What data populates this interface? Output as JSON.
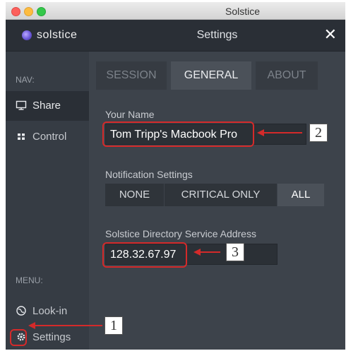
{
  "window": {
    "title": "Solstice"
  },
  "logo": {
    "text": "solstice"
  },
  "sidebar": {
    "nav_label": "NAV:",
    "nav_items": [
      {
        "label": "Share",
        "icon": "monitor-icon"
      },
      {
        "label": "Control",
        "icon": "grid-icon"
      }
    ],
    "menu_label": "MENU:",
    "menu_items": [
      {
        "label": "Look-in",
        "icon": "globe-icon"
      },
      {
        "label": "Settings",
        "icon": "gear-icon"
      }
    ]
  },
  "header": {
    "title": "Settings",
    "close": "✕"
  },
  "tabs": [
    {
      "label": "SESSION"
    },
    {
      "label": "GENERAL",
      "active": true
    },
    {
      "label": "ABOUT"
    }
  ],
  "general": {
    "name_label": "Your Name",
    "name_value": "Tom Tripp's Macbook Pro",
    "notif_label": "Notification Settings",
    "notif_options": [
      "NONE",
      "CRITICAL ONLY",
      "ALL"
    ],
    "notif_selected": "ALL",
    "dir_label": "Solstice Directory Service Address",
    "dir_value": "128.32.67.97"
  },
  "annotations": {
    "one": "1",
    "two": "2",
    "three": "3"
  },
  "colors": {
    "highlight": "#d42a2a",
    "sidebar_bg": "#363c44",
    "main_bg": "#3d434b",
    "active_tab": "#4b5159"
  }
}
